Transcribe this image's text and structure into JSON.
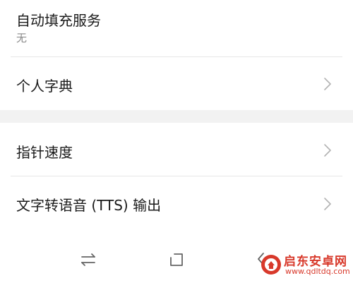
{
  "settings": {
    "autofill": {
      "label": "自动填充服务",
      "value": "无"
    },
    "personal_dictionary": {
      "label": "个人字典"
    },
    "pointer_speed": {
      "label": "指针速度"
    },
    "tts_output": {
      "label": "文字转语音 (TTS) 输出"
    }
  },
  "nav": {
    "buttons": [
      "recents-icon",
      "home-icon",
      "back-icon"
    ]
  },
  "watermark": {
    "title": "启东安卓网",
    "url": "www.qdltdq.com"
  },
  "colors": {
    "background": "#ffffff",
    "section_gap": "#f2f2f2",
    "divider": "#e6e6e6",
    "chevron": "#b3b3b3",
    "watermark": "#d8392b"
  }
}
